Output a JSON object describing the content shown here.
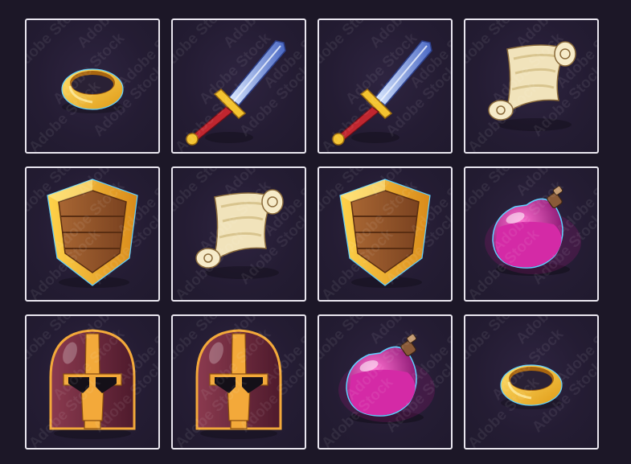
{
  "board": {
    "rows": 3,
    "columns": 4,
    "tiles": [
      {
        "item": "ring"
      },
      {
        "item": "sword"
      },
      {
        "item": "sword"
      },
      {
        "item": "scroll"
      },
      {
        "item": "shield"
      },
      {
        "item": "scroll"
      },
      {
        "item": "shield"
      },
      {
        "item": "potion"
      },
      {
        "item": "helmet"
      },
      {
        "item": "helmet"
      },
      {
        "item": "potion"
      },
      {
        "item": "ring"
      }
    ]
  },
  "watermark": {
    "text": "Adobe Stock"
  },
  "colors": {
    "background": "#1c1727",
    "tile_fill": "#241c33",
    "tile_border": "#e9e6ef",
    "gold": "#f2b62a",
    "steel": "#6f8fd6",
    "parchment": "#f1e3bb",
    "wood": "#9a5b2b",
    "potion": "#c2188f",
    "helmet": "#6b2439"
  }
}
